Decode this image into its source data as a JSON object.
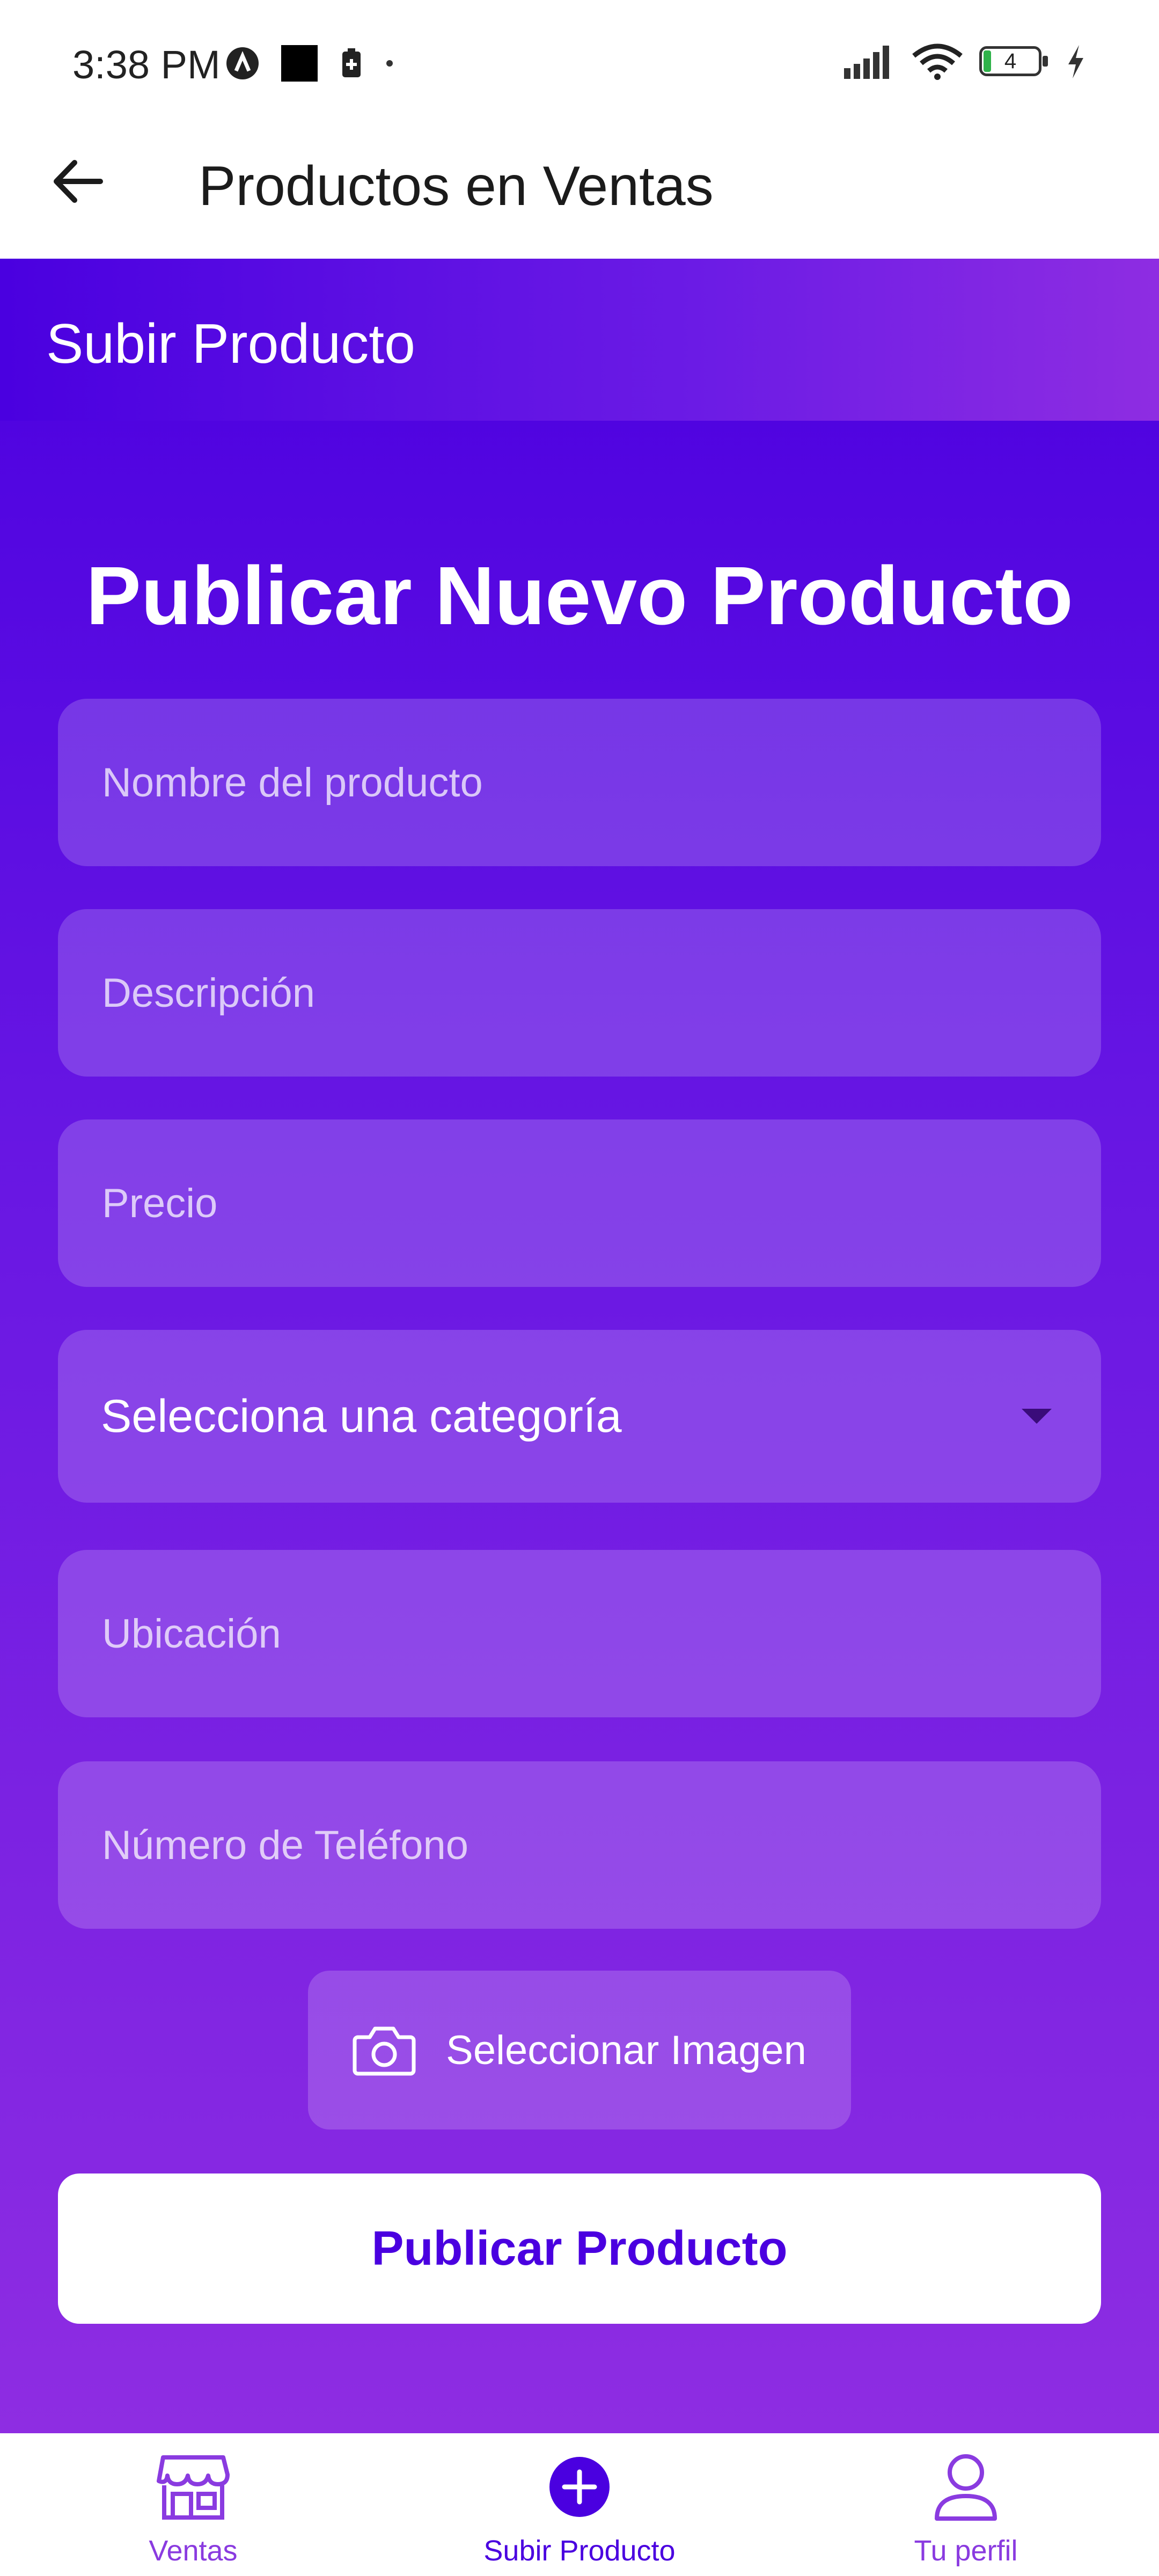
{
  "status_bar": {
    "time": "3:38 PM",
    "battery": "4"
  },
  "app_bar": {
    "title": "Productos en Ventas"
  },
  "section": {
    "title": "Subir Producto"
  },
  "form": {
    "title": "Publicar Nuevo Producto",
    "fields": [
      {
        "placeholder": "Nombre del producto"
      },
      {
        "placeholder": "Descripción"
      },
      {
        "placeholder": "Precio"
      },
      {
        "placeholder": "Ubicación"
      },
      {
        "placeholder": "Número de Teléfono"
      }
    ],
    "category_select": {
      "label": "Selecciona una categoría"
    },
    "image_button": {
      "label": "Seleccionar Imagen"
    },
    "submit_button": {
      "label": "Publicar Producto"
    }
  },
  "bottom_nav": {
    "items": [
      {
        "label": "Ventas"
      },
      {
        "label": "Subir Producto"
      },
      {
        "label": "Tu perfil"
      }
    ]
  },
  "colors": {
    "primary": "#4a00e0",
    "accent": "#8e2de2"
  }
}
